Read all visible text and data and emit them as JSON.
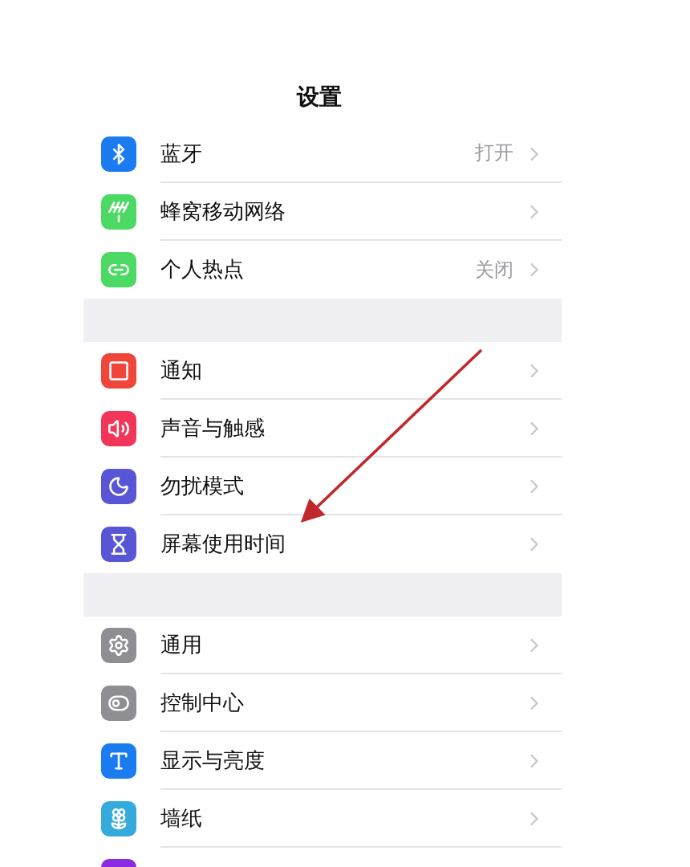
{
  "title": "设置",
  "groups": [
    {
      "items": [
        {
          "label": "蓝牙",
          "value": "打开",
          "kind": "bluetooth",
          "color": "#1a7cf0"
        },
        {
          "label": "蜂窝移动网络",
          "kind": "cellular",
          "color": "#4cd964"
        },
        {
          "label": "个人热点",
          "value": "关闭",
          "kind": "hotspot",
          "color": "#4cd964"
        }
      ]
    },
    {
      "items": [
        {
          "label": "通知",
          "kind": "notifications",
          "color": "#f0453a"
        },
        {
          "label": "声音与触感",
          "kind": "sound",
          "color": "#f2365a"
        },
        {
          "label": "勿扰模式",
          "kind": "moon",
          "color": "#5856d6"
        },
        {
          "label": "屏幕使用时间",
          "kind": "hourglass",
          "color": "#5856d6"
        }
      ]
    },
    {
      "items": [
        {
          "label": "通用",
          "kind": "gear",
          "color": "#8e8e93"
        },
        {
          "label": "控制中心",
          "kind": "toggles",
          "color": "#8e8e93"
        },
        {
          "label": "显示与亮度",
          "kind": "display",
          "color": "#1a7cf0"
        },
        {
          "label": "墙纸",
          "kind": "flower",
          "color": "#35aadc"
        },
        {
          "kind": "partial",
          "color": "#8a2be2"
        }
      ]
    }
  ]
}
